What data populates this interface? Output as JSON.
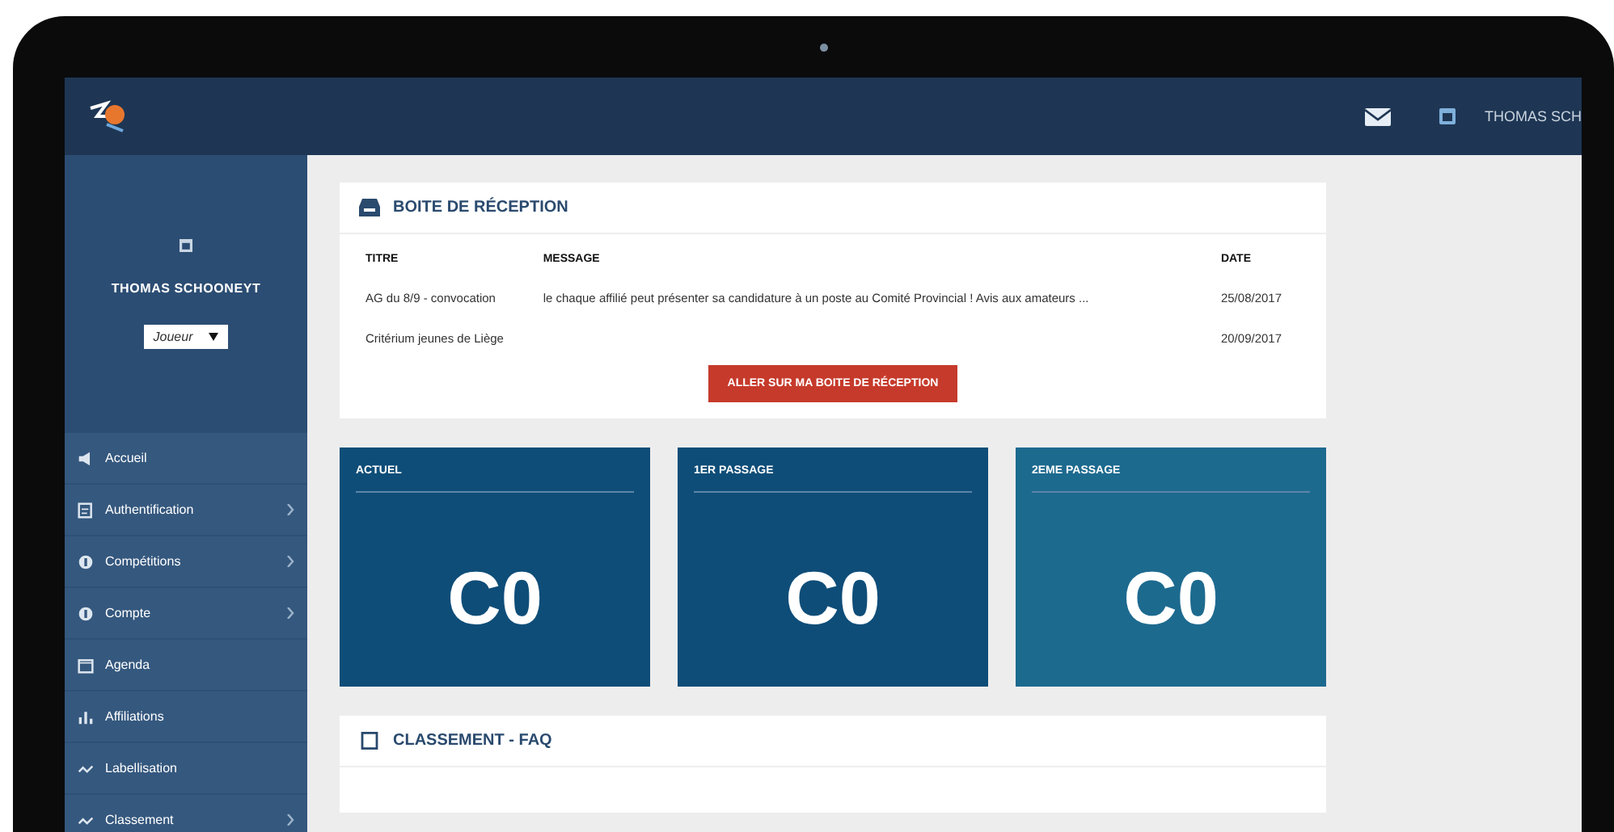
{
  "header": {
    "user_name": "THOMAS SCH"
  },
  "sidebar": {
    "profile": {
      "name": "THOMAS SCHOONEYT",
      "role": "Joueur"
    },
    "items": [
      {
        "label": "Accueil",
        "has_submenu": false
      },
      {
        "label": "Authentification",
        "has_submenu": true
      },
      {
        "label": "Compétitions",
        "has_submenu": true
      },
      {
        "label": "Compte",
        "has_submenu": true
      },
      {
        "label": "Agenda",
        "has_submenu": false
      },
      {
        "label": "Affiliations",
        "has_submenu": false
      },
      {
        "label": "Labellisation",
        "has_submenu": false
      },
      {
        "label": "Classement",
        "has_submenu": true
      }
    ]
  },
  "inbox": {
    "title": "BOITE DE RÉCEPTION",
    "columns": [
      "TITRE",
      "MESSAGE",
      "DATE"
    ],
    "rows": [
      [
        "AG du 8/9 - convocation",
        "le chaque affilié peut présenter sa candidature à un poste au Comité Provincial ! Avis aux amateurs ...",
        "25/08/2017"
      ],
      [
        "Critérium jeunes de Liège",
        "",
        "20/09/2017"
      ]
    ],
    "button": "ALLER SUR MA BOITE DE RÉCEPTION"
  },
  "tiles": [
    {
      "label": "ACTUEL",
      "value": "C0",
      "color": "#0e4d78"
    },
    {
      "label": "1ER PASSAGE",
      "value": "C0",
      "color": "#0e4d78"
    },
    {
      "label": "2EME PASSAGE",
      "value": "C0",
      "color": "#1d6a8f"
    }
  ],
  "faq": {
    "title": "CLASSEMENT - FAQ"
  }
}
